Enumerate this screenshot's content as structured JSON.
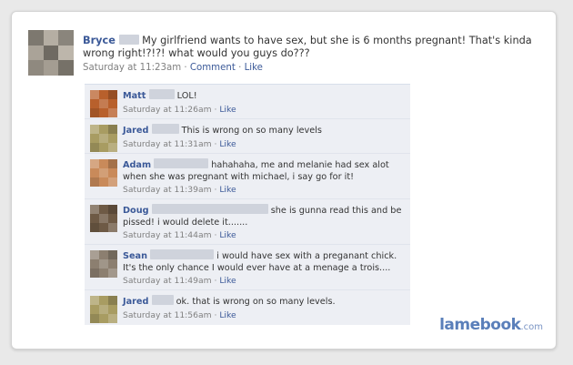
{
  "post": {
    "author": "Bryce",
    "text": "My girlfriend wants to have sex, but she is 6 months pregnant! That's kinda wrong right!?!?! what would you guys do???",
    "time": "Saturday at 11:23am",
    "comment_label": "Comment",
    "like_label": "Like",
    "separator": "·"
  },
  "comments": [
    {
      "author": "Matt",
      "text": "LOL!",
      "time": "Saturday at 11:26am",
      "like": "Like",
      "avatar_color": "#b8602c"
    },
    {
      "author": "Jared",
      "text": "This is wrong on so many levels",
      "time": "Saturday at 11:31am",
      "like": "Like",
      "avatar_color": "#a89c62"
    },
    {
      "author": "Adam",
      "text": "hahahaha, me and melanie had sex alot when she was pregnant with michael, i say go for it!",
      "time": "Saturday at 11:39am",
      "like": "Like",
      "avatar_color": "#c98a5a"
    },
    {
      "author": "Doug",
      "text": "she is gunna read this and be pissed! i would delete it.......",
      "time": "Saturday at 11:44am",
      "like": "Like",
      "avatar_color": "#6e5a45"
    },
    {
      "author": "Sean",
      "text": "i would have sex with a preganant chick. It's the only chance I would ever have at a menage a trois....",
      "time": "Saturday at 11:49am",
      "like": "Like",
      "avatar_color": "#8c7f70"
    },
    {
      "author": "Jared",
      "text": "ok. that is wrong on so many levels.",
      "time": "Saturday at 11:56am",
      "like": "Like",
      "avatar_color": "#a89c62"
    }
  ],
  "brand": {
    "name": "lamebook",
    ".com": ".com",
    "suffix": ".com"
  }
}
